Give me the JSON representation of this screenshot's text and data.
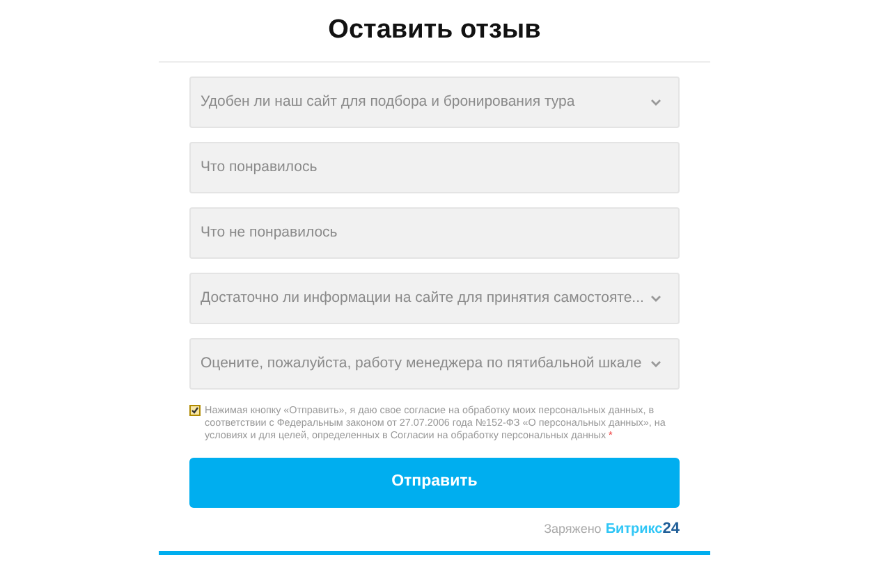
{
  "title": "Оставить отзыв",
  "fields": [
    {
      "kind": "select",
      "placeholder": "Удобен ли наш сайт для подбора и бронирования тура"
    },
    {
      "kind": "text",
      "placeholder": "Что понравилось"
    },
    {
      "kind": "text",
      "placeholder": "Что не понравилось"
    },
    {
      "kind": "select",
      "placeholder": "Достаточно ли информации на сайте для принятия самостояте..."
    },
    {
      "kind": "select",
      "placeholder": "Оцените, пожалуйста, работу менеджера по пятибальной шкале"
    }
  ],
  "consent": {
    "checked": true,
    "text": "Нажимая кнопку «Отправить», я даю свое согласие на обработку моих персональных данных, в соответствии с Федеральным законом от 27.07.2006 года №152-ФЗ «О персональных данных», на условиях и для целей, определенных в Согласии на обработку персональных данных",
    "required_mark": "*"
  },
  "submit": "Отправить",
  "footer": {
    "label": "Заряжено",
    "brand": "Битрикс",
    "brand_number": "24"
  }
}
